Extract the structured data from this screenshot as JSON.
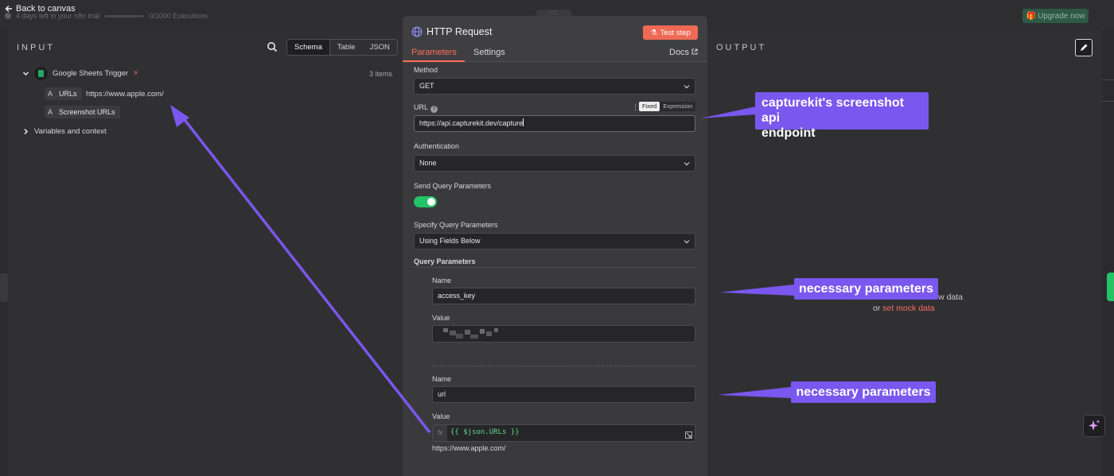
{
  "topbar": {
    "back_label": "Back to canvas",
    "trial_text": "4 days left in your n8n trial",
    "executions": "0/1000 Executions",
    "upgrade_label": "Upgrade now",
    "drag_handle": "::::"
  },
  "input": {
    "title": "INPUT",
    "views": [
      "Schema",
      "Table",
      "JSON"
    ],
    "active_view": "Schema",
    "trigger_name": "Google Sheets Trigger",
    "items_count": "3 items",
    "fields": [
      {
        "type": "A",
        "name": "URLs",
        "value": "https://www.apple.com/"
      },
      {
        "type": "A",
        "name": "Screenshot URLs",
        "value": ""
      }
    ],
    "variables_label": "Variables and context"
  },
  "node": {
    "title": "HTTP Request",
    "test_label": "Test step",
    "tabs": [
      "Parameters",
      "Settings"
    ],
    "active_tab": "Parameters",
    "docs_label": "Docs",
    "method": {
      "label": "Method",
      "value": "GET"
    },
    "url": {
      "label": "URL",
      "value": "https://api.capturekit.dev/capture",
      "mode_fixed": "Fixed",
      "mode_expression": "Expression"
    },
    "authentication": {
      "label": "Authentication",
      "value": "None"
    },
    "send_query": {
      "label": "Send Query Parameters",
      "enabled": true
    },
    "specify_query": {
      "label": "Specify Query Parameters",
      "value": "Using Fields Below"
    },
    "query_params_label": "Query Parameters",
    "params": [
      {
        "name_label": "Name",
        "name_value": "access_key",
        "value_label": "Value"
      },
      {
        "name_label": "Name",
        "name_value": "url",
        "value_label": "Value",
        "expression": "{{ $json.URLs }}",
        "expression_result": "https://www.apple.com/"
      }
    ]
  },
  "output": {
    "title": "OUTPUT",
    "empty_hint": "Execute this node to view data",
    "mock_prefix": "or ",
    "mock_link": "set mock data"
  },
  "annotations": {
    "callout_endpoint": [
      "capturekit's screenshot api",
      "endpoint"
    ],
    "callout_params_1": "necessary parameters",
    "callout_params_2": "necessary parameters",
    "color": "#7a57ee"
  },
  "colors": {
    "accent": "#ff6d5a",
    "toggle_on": "#23c468",
    "panel": "#303033",
    "node_panel": "#3a3a3d",
    "expression_text": "#5ed98c"
  }
}
